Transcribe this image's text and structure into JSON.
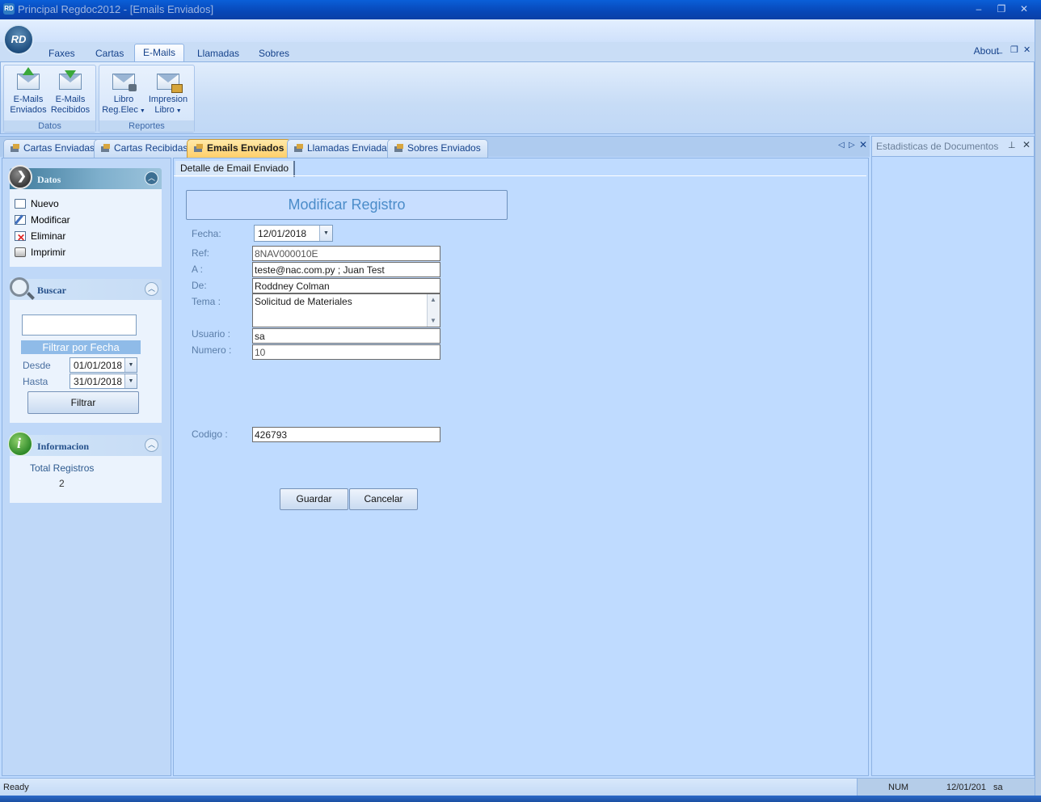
{
  "window": {
    "title": "Principal Regdoc2012 - [Emails Enviados]",
    "app_icon": "RD",
    "controls": [
      "minimize",
      "restore",
      "close"
    ]
  },
  "app_orb": "RD",
  "ribbon": {
    "tabs": [
      {
        "label": "Faxes"
      },
      {
        "label": "Cartas"
      },
      {
        "label": "E-Mails",
        "active": true
      },
      {
        "label": "Llamadas"
      },
      {
        "label": "Sobres"
      }
    ],
    "about_label": "About",
    "groups": [
      {
        "label": "Datos",
        "buttons": [
          {
            "line1": "E-Mails",
            "line2": "Enviados",
            "icon": "mail-upload-icon"
          },
          {
            "line1": "E-Mails",
            "line2": "Recibidos",
            "icon": "mail-download-icon"
          }
        ]
      },
      {
        "label": "Reportes",
        "buttons": [
          {
            "line1": "Libro",
            "line2": "Reg.Elec",
            "icon": "mail-lock-icon"
          },
          {
            "line1": "Impresion",
            "line2": "Libro",
            "icon": "mail-print-icon"
          }
        ]
      }
    ]
  },
  "doc_tabs": [
    {
      "label": "Cartas Enviadas"
    },
    {
      "label": "Cartas Recibidas"
    },
    {
      "label": "Emails Enviados",
      "active": true
    },
    {
      "label": "Llamadas Enviadas"
    },
    {
      "label": "Sobres Enviados"
    }
  ],
  "right_pane": {
    "title": "Estadisticas de Documentos"
  },
  "left": {
    "datos": {
      "title": "Datos",
      "items": [
        {
          "label": "Nuevo",
          "icon": "folder-icon"
        },
        {
          "label": "Modificar",
          "icon": "edit-icon"
        },
        {
          "label": "Eliminar",
          "icon": "delete-icon"
        },
        {
          "label": "Imprimir",
          "icon": "printer-icon"
        }
      ]
    },
    "buscar": {
      "title": "Buscar",
      "search_value": "",
      "filter_header": "Filtrar por Fecha",
      "desde_label": "Desde",
      "desde_value": "01/01/2018",
      "hasta_label": "Hasta",
      "hasta_value": "31/01/2018",
      "filter_button": "Filtrar"
    },
    "info": {
      "title": "Informacion",
      "total_label": "Total Registros",
      "total_value": "2"
    }
  },
  "form": {
    "subtab": "Detalle de Email Enviado",
    "title": "Modificar Registro",
    "fecha_label": "Fecha:",
    "fecha_value": "12/01/2018",
    "ref_label": "Ref:",
    "ref_value": "8NAV000010E",
    "a_label": "A :",
    "a_value": "teste@nac.com.py ; Juan Test",
    "de_label": "De:",
    "de_value": "Roddney Colman",
    "tema_label": "Tema :",
    "tema_value": "Solicitud de Materiales",
    "usuario_label": "Usuario :",
    "usuario_value": "sa",
    "numero_label": "Numero :",
    "numero_value": "10",
    "codigo_label": "Codigo :",
    "codigo_value": "426793",
    "save_label": "Guardar",
    "cancel_label": "Cancelar"
  },
  "status": {
    "ready": "Ready",
    "num": "NUM",
    "date": "12/01/201",
    "user": "sa"
  }
}
